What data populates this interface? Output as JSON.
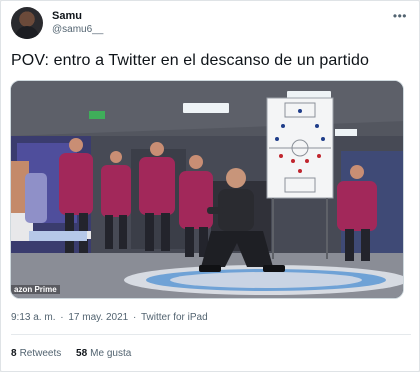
{
  "user": {
    "display_name": "Samu",
    "handle": "@samu6__"
  },
  "menu": {
    "more_icon": "more-horizontal-icon",
    "more_glyph": "•••"
  },
  "tweet": {
    "text": "POV: entro a Twitter en el descanso de un partido",
    "media": {
      "watermark": "azon Prime"
    },
    "time": "9:13 a. m.",
    "date": "17 may. 2021",
    "source": "Twitter for iPad",
    "separator": "·"
  },
  "stats": {
    "retweets_count": "8",
    "retweets_label": "Retweets",
    "likes_count": "58",
    "likes_label": "Me gusta"
  },
  "colors": {
    "secondary_text": "#536471",
    "team_kit": "#a2285a",
    "text": "#0f1419"
  }
}
